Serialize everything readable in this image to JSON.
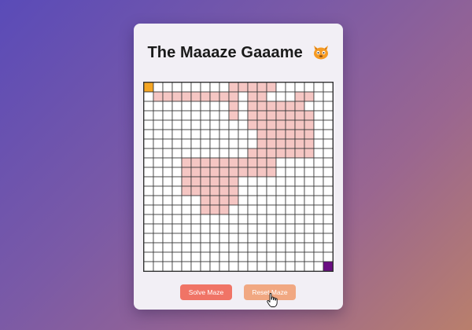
{
  "header": {
    "title": "The Maaaze Gaaame",
    "title_icon": "cat-face-icon"
  },
  "maze": {
    "rows": 20,
    "cols": 20,
    "start_color": "#f5a623",
    "end_color": "#6a0d83",
    "path_color": "#f5c6c3",
    "wall_color": "#333333",
    "path_cells": [
      [
        1,
        1
      ],
      [
        1,
        2
      ],
      [
        1,
        3
      ],
      [
        1,
        4
      ],
      [
        1,
        5
      ],
      [
        1,
        6
      ],
      [
        1,
        7
      ],
      [
        1,
        8
      ],
      [
        0,
        10
      ],
      [
        0,
        11
      ],
      [
        0,
        12
      ],
      [
        0,
        13
      ],
      [
        0,
        9
      ],
      [
        1,
        9
      ],
      [
        2,
        9
      ],
      [
        3,
        9
      ],
      [
        1,
        11
      ],
      [
        2,
        11
      ],
      [
        3,
        11
      ],
      [
        4,
        11
      ],
      [
        1,
        12
      ],
      [
        2,
        12
      ],
      [
        3,
        12
      ],
      [
        4,
        12
      ],
      [
        2,
        13
      ],
      [
        2,
        14
      ],
      [
        2,
        15
      ],
      [
        2,
        16
      ],
      [
        1,
        16
      ],
      [
        1,
        17
      ],
      [
        3,
        16
      ],
      [
        3,
        17
      ],
      [
        3,
        13
      ],
      [
        3,
        14
      ],
      [
        3,
        15
      ],
      [
        3,
        16
      ],
      [
        3,
        17
      ],
      [
        4,
        13
      ],
      [
        4,
        14
      ],
      [
        4,
        15
      ],
      [
        4,
        16
      ],
      [
        4,
        17
      ],
      [
        5,
        12
      ],
      [
        5,
        13
      ],
      [
        5,
        14
      ],
      [
        5,
        15
      ],
      [
        5,
        16
      ],
      [
        5,
        17
      ],
      [
        6,
        12
      ],
      [
        6,
        13
      ],
      [
        6,
        14
      ],
      [
        6,
        15
      ],
      [
        6,
        16
      ],
      [
        6,
        17
      ],
      [
        7,
        11
      ],
      [
        7,
        12
      ],
      [
        7,
        13
      ],
      [
        7,
        14
      ],
      [
        7,
        15
      ],
      [
        7,
        16
      ],
      [
        7,
        17
      ],
      [
        8,
        11
      ],
      [
        8,
        12
      ],
      [
        8,
        13
      ],
      [
        9,
        11
      ],
      [
        9,
        12
      ],
      [
        9,
        13
      ],
      [
        8,
        8
      ],
      [
        8,
        9
      ],
      [
        8,
        10
      ],
      [
        9,
        8
      ],
      [
        9,
        9
      ],
      [
        9,
        10
      ],
      [
        10,
        8
      ],
      [
        10,
        9
      ],
      [
        11,
        8
      ],
      [
        11,
        9
      ],
      [
        12,
        7
      ],
      [
        12,
        8
      ],
      [
        12,
        9
      ],
      [
        13,
        6
      ],
      [
        13,
        7
      ],
      [
        13,
        8
      ],
      [
        8,
        4
      ],
      [
        8,
        5
      ],
      [
        8,
        6
      ],
      [
        8,
        7
      ],
      [
        9,
        4
      ],
      [
        9,
        5
      ],
      [
        9,
        6
      ],
      [
        9,
        7
      ],
      [
        10,
        4
      ],
      [
        10,
        5
      ],
      [
        10,
        6
      ],
      [
        10,
        7
      ],
      [
        11,
        4
      ],
      [
        11,
        5
      ],
      [
        11,
        6
      ],
      [
        11,
        7
      ],
      [
        12,
        6
      ],
      [
        13,
        6
      ]
    ],
    "start_cell": [
      0,
      0
    ],
    "end_cell": [
      19,
      19
    ]
  },
  "buttons": {
    "solve_label": "Solve Maze",
    "reset_label": "Reset Maze"
  }
}
